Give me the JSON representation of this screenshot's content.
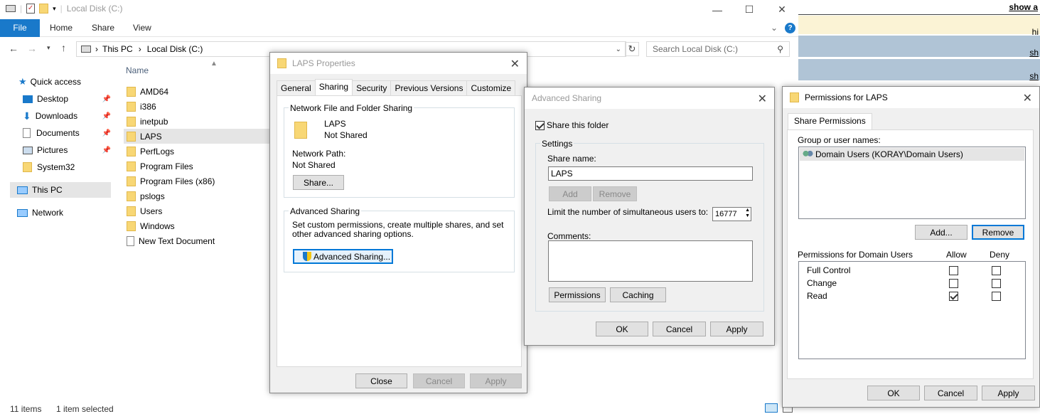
{
  "explorer": {
    "title": "Local Disk (C:)",
    "ribbon_tabs": [
      "File",
      "Home",
      "Share",
      "View"
    ],
    "address": {
      "crumbs": [
        "This PC",
        "Local Disk (C:)"
      ],
      "search_placeholder": "Search Local Disk (C:)"
    },
    "column_header": "Name",
    "nav": {
      "quick_access": "Quick access",
      "pinned": [
        "Desktop",
        "Downloads",
        "Documents",
        "Pictures"
      ],
      "other": "System32",
      "this_pc": "This PC",
      "network": "Network"
    },
    "files": [
      "AMD64",
      "i386",
      "inetpub",
      "LAPS",
      "PerfLogs",
      "Program Files",
      "Program Files (x86)",
      "pslogs",
      "Users",
      "Windows",
      "New Text Document"
    ],
    "selected_file": "LAPS",
    "status": {
      "items": "11 items",
      "selected": "1 item selected"
    }
  },
  "strip": {
    "lines": [
      "show a",
      "hi",
      "sh",
      "sh"
    ]
  },
  "laps_properties": {
    "title": "LAPS Properties",
    "tabs": [
      "General",
      "Sharing",
      "Security",
      "Previous Versions",
      "Customize"
    ],
    "active_tab": "Sharing",
    "net_group": "Network File and Folder Sharing",
    "folder_name": "LAPS",
    "folder_status": "Not Shared",
    "network_path_label": "Network Path:",
    "network_path_value": "Not Shared",
    "share_button": "Share...",
    "adv_group": "Advanced Sharing",
    "adv_desc": "Set custom permissions, create multiple shares, and set other advanced sharing options.",
    "adv_button": "Advanced Sharing...",
    "close": "Close",
    "cancel": "Cancel",
    "apply": "Apply"
  },
  "advanced_sharing": {
    "title": "Advanced Sharing",
    "share_checkbox": "Share this folder",
    "share_checked": true,
    "settings_group": "Settings",
    "share_name_label": "Share name:",
    "share_name_value": "LAPS",
    "add": "Add",
    "remove": "Remove",
    "limit_label": "Limit the number of simultaneous users to:",
    "limit_value": "16777",
    "comments_label": "Comments:",
    "permissions": "Permissions",
    "caching": "Caching",
    "ok": "OK",
    "cancel": "Cancel",
    "apply": "Apply"
  },
  "permissions": {
    "title": "Permissions for LAPS",
    "tab": "Share Permissions",
    "group_label": "Group or user names:",
    "users": [
      "Domain Users (KORAY\\Domain Users)"
    ],
    "add": "Add...",
    "remove": "Remove",
    "perm_label": "Permissions for Domain Users",
    "allow": "Allow",
    "deny": "Deny",
    "rows": [
      {
        "name": "Full Control",
        "allow": false,
        "deny": false
      },
      {
        "name": "Change",
        "allow": false,
        "deny": false
      },
      {
        "name": "Read",
        "allow": true,
        "deny": false
      }
    ],
    "ok": "OK",
    "cancel": "Cancel",
    "apply": "Apply"
  }
}
